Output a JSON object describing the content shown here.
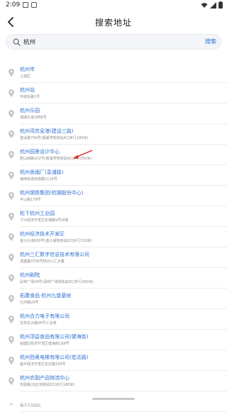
{
  "status_bar": {
    "time": "2:09"
  },
  "header": {
    "title": "搜索地址"
  },
  "search": {
    "value": "杭州",
    "button_label": "搜索"
  },
  "results": [
    {
      "name": "杭州市",
      "address": "上城区"
    },
    {
      "name": "杭州站",
      "address": "环城东路1号"
    },
    {
      "name": "杭州乐园",
      "address": "湘湖大道2888号"
    },
    {
      "name": "杭州湾信息港(建设三路)",
      "address": "建设路799号(湘湖湾地铁站A口步行180米)"
    },
    {
      "name": "杭州园景设计中心",
      "address": "宸山西路102号(南湖湾地铁站A口步行250米)"
    },
    {
      "name": "杭州香烟厂(袁浦路)",
      "address": "瑞南街道杭南路1119号"
    },
    {
      "name": "杭州钢铁集团(杭钢股份中心)",
      "address": "半山路178号"
    },
    {
      "name": "松下杭州工业园",
      "address": "下沙经济开发区松港路9号(6幢"
    },
    {
      "name": "杭州经济技术开发区",
      "address": "金沙大道600号(金沙湖地铁站D口步行130米)"
    },
    {
      "name": "杭州三汇数字信息技术有限公司",
      "address": "滨盛路3756号杭州三汇大厦"
    },
    {
      "name": "杭州剧院",
      "address": "武林广场29号(武林广场地铁站D口步行300米)"
    },
    {
      "name": "拓康食品·杭州九堡基地",
      "address": "九环路29号"
    },
    {
      "name": "杭州合力电子有限公司",
      "address": "龙泉东大路66号工业城"
    },
    {
      "name": "杭州顶益食品有限公司(健海街)",
      "address": "钱塘区经济开发区健海街188号"
    },
    {
      "name": "杭州西奥电梯有限公司(宏达路)",
      "address": "临平经济开发区宏达路168号"
    },
    {
      "name": "杭州农副产品物流中心",
      "address": "农副路(勾庄地铁站D口步行180米)"
    },
    {
      "name": "杭州发山化工有限公司",
      "address": "临江工业园区"
    }
  ],
  "colors": {
    "link": "#2e6fd0",
    "accent": "#2b73d9",
    "muted": "#8c8c8c",
    "pin": "#c7c7c7",
    "annotation_arrow": "#e02020"
  },
  "icons": {
    "back": "chevron-left-icon",
    "search": "search-icon",
    "pin": "location-pin-icon"
  }
}
